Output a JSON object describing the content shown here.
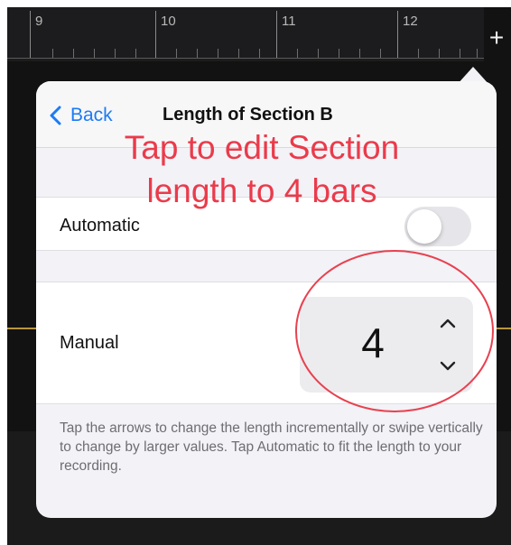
{
  "ruler": {
    "numbers": [
      "9",
      "10",
      "11",
      "12"
    ]
  },
  "toolbar": {
    "add_label": "+"
  },
  "popover": {
    "back_label": "Back",
    "title": "Length of Section B"
  },
  "automatic": {
    "label": "Automatic",
    "enabled": false
  },
  "manual": {
    "label": "Manual",
    "value": "4"
  },
  "footer_note": "Tap the arrows to change the length incrementally or swipe vertically to change by larger values. Tap Automatic to fit the length to your recording.",
  "annotation": {
    "line1": "Tap to edit Section",
    "line2": "length to 4 bars"
  },
  "colors": {
    "accent": "#1b7bf5",
    "annotation": "#ea3b4b",
    "popover_bg": "#f2f2f7"
  },
  "icons": {
    "back": "chevron-left-icon",
    "increment": "chevron-up-icon",
    "decrement": "chevron-down-icon",
    "add": "plus-icon"
  }
}
